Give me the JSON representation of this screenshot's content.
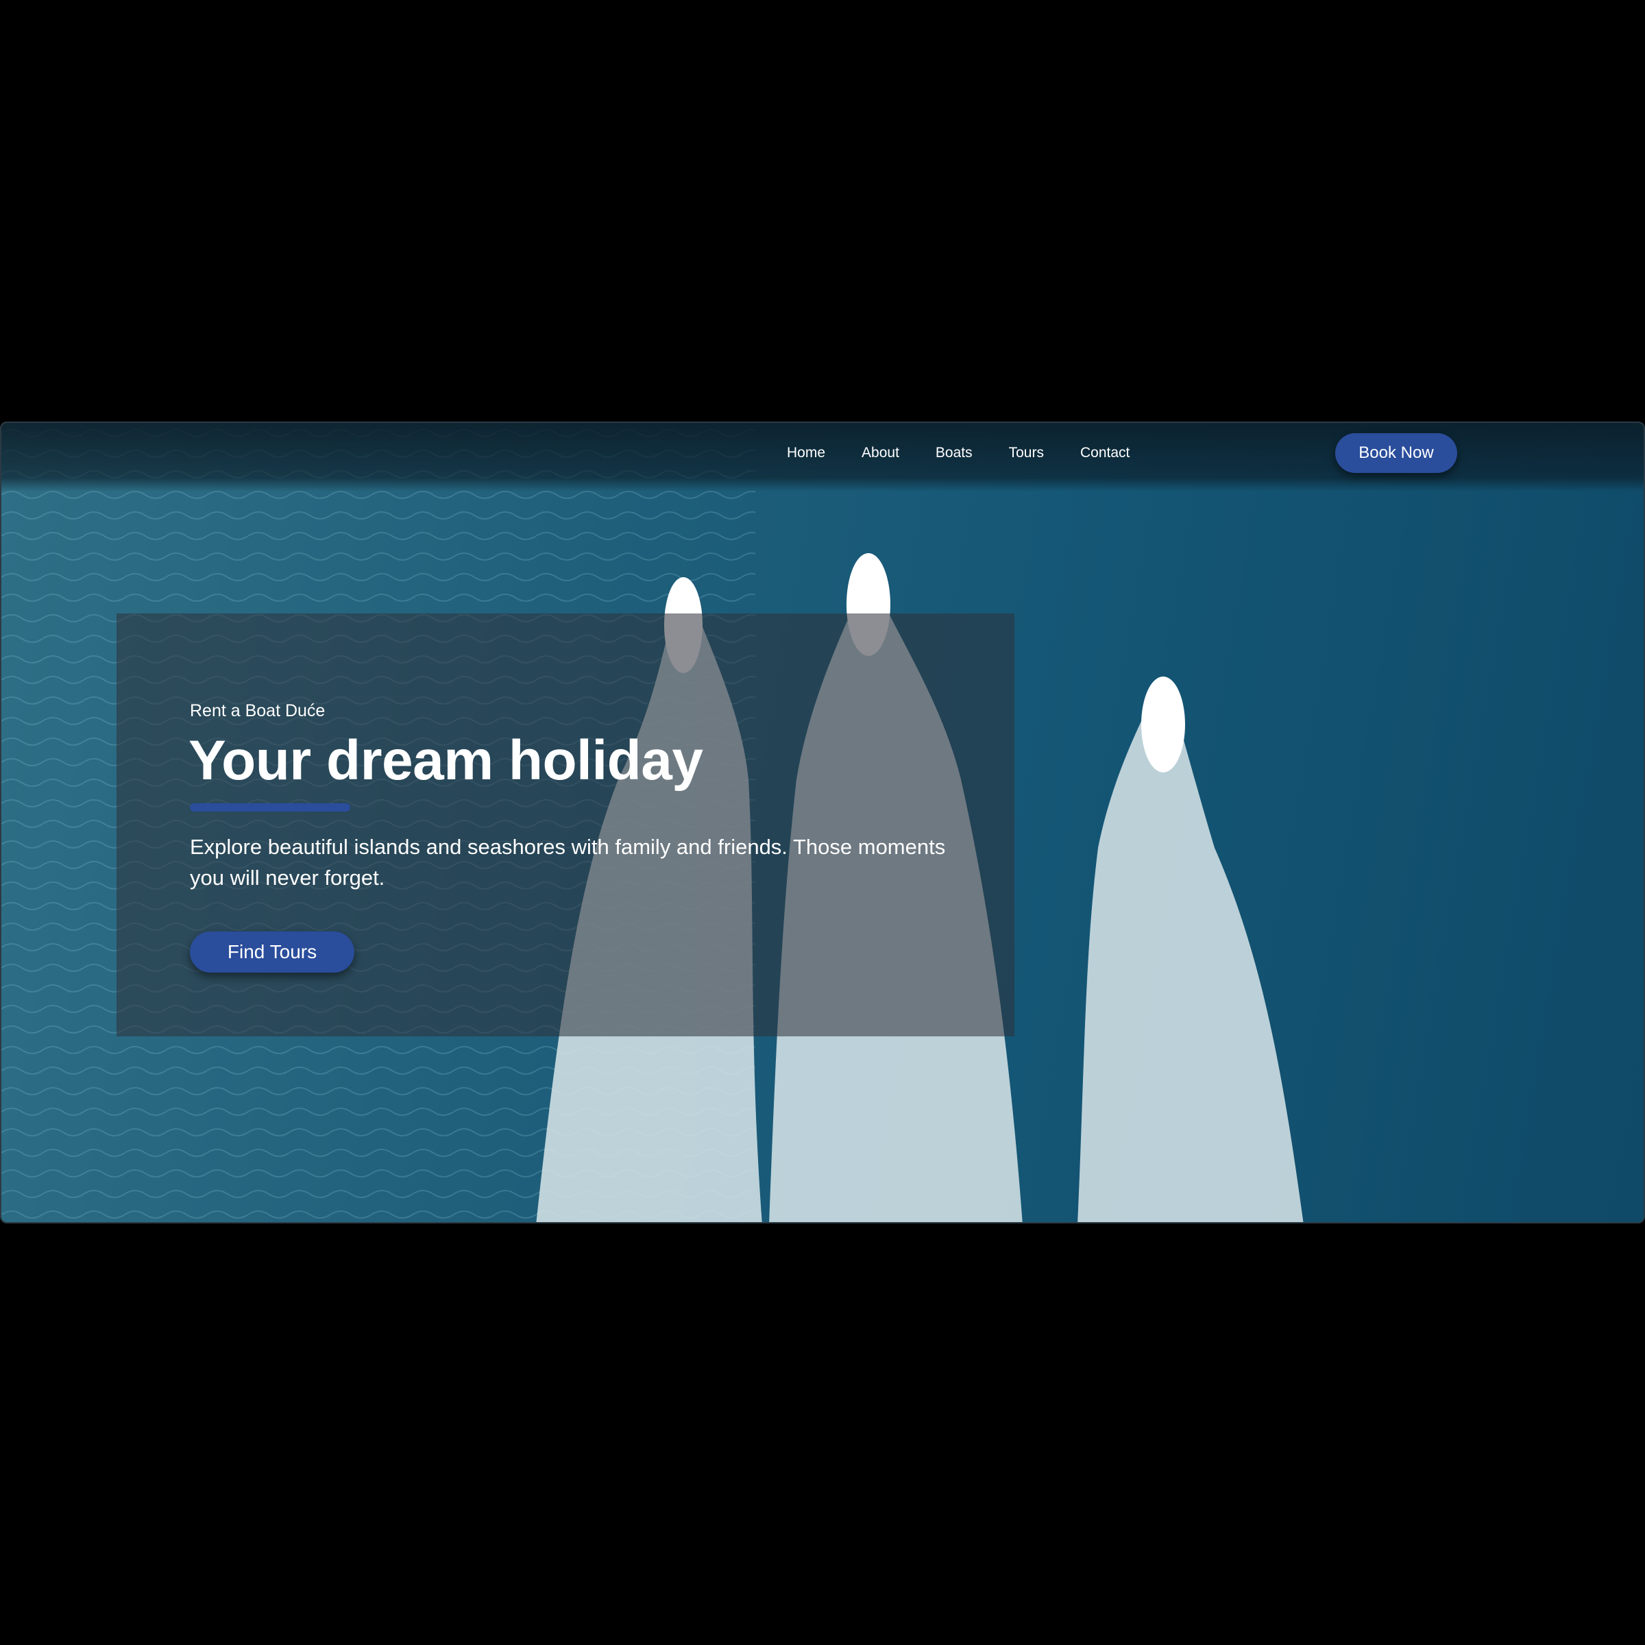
{
  "nav": {
    "items": [
      {
        "label": "Home"
      },
      {
        "label": "About"
      },
      {
        "label": "Boats"
      },
      {
        "label": "Tours"
      },
      {
        "label": "Contact"
      }
    ],
    "cta_label": "Book Now"
  },
  "hero": {
    "eyebrow": "Rent a Boat Duće",
    "title": "Your dream holiday",
    "description": "Explore beautiful islands and seashores with family and friends. Those moments you will never forget.",
    "button_label": "Find Tours"
  },
  "colors": {
    "accent": "#2a4d9c",
    "sea": "#155776",
    "panel": "#2d323a"
  }
}
